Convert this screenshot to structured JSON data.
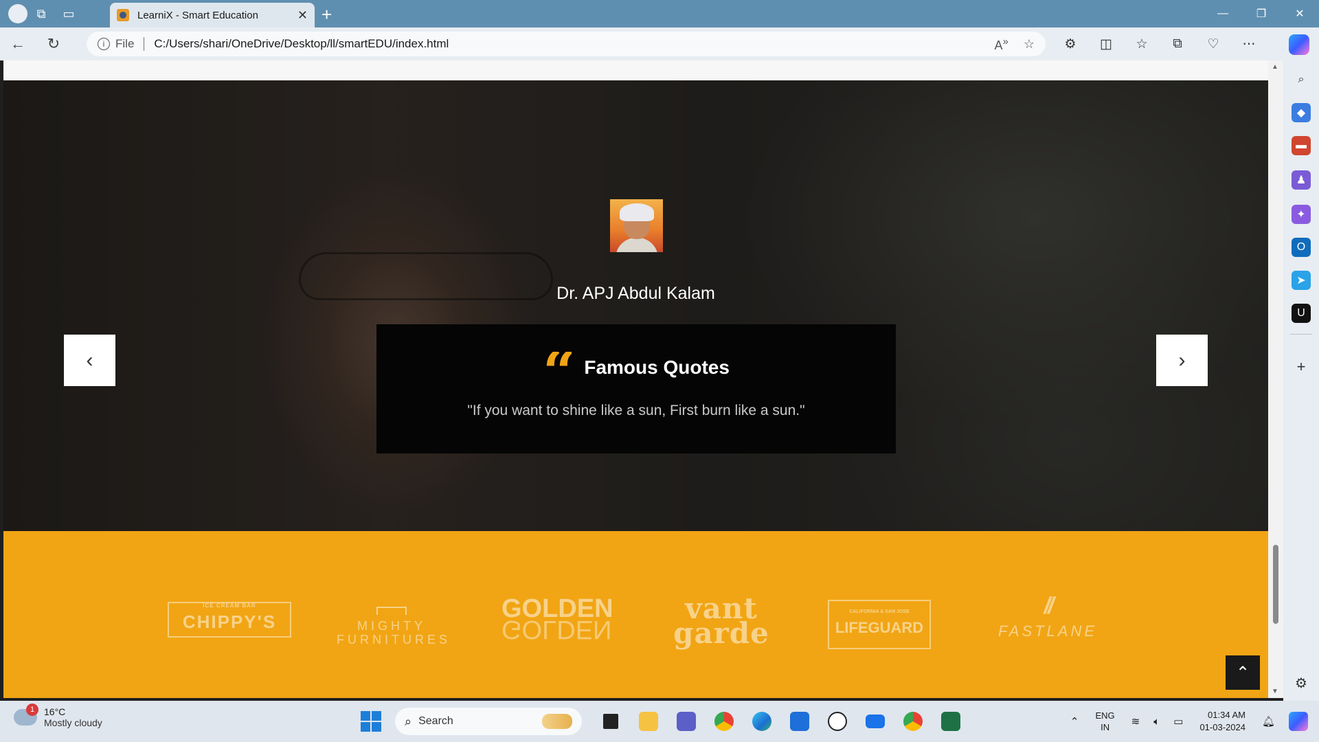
{
  "browser": {
    "tab_title": "LearniX - Smart Education",
    "scheme_label": "File",
    "url": "C:/Users/shari/OneDrive/Desktop/ll/smartEDU/index.html"
  },
  "hero": {
    "person_name": "Dr. APJ Abdul Kalam",
    "quote_title": "Famous Quotes",
    "quote_text": "\"If you want to shine like a sun, First burn like a sun.\""
  },
  "brands": {
    "chippys": "CHIPPY'S",
    "chippys_small": "ICE CREAM BAR",
    "mighty": "MIGHTY FURNITURES",
    "golden": "GOLDEN",
    "vantgarde": "vant garde",
    "lifeguard": "LIFEGUARD",
    "lifeguard_small": "CALIFORNIA & SAN JOSE",
    "fastlane": "FASTLANE"
  },
  "taskbar": {
    "temperature": "16°C",
    "condition": "Mostly cloudy",
    "weather_badge": "1",
    "search_placeholder": "Search",
    "lang_line1": "ENG",
    "lang_line2": "IN",
    "time": "01:34 AM",
    "date": "01-03-2024"
  },
  "colors": {
    "accent": "#f1a514",
    "quote_box": "#050505",
    "tabbar": "#5f8fb0"
  }
}
